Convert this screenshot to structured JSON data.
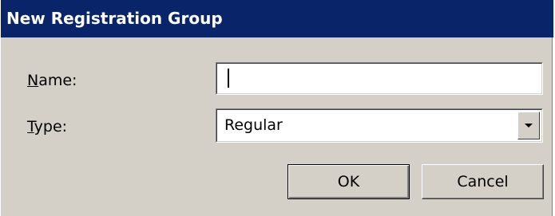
{
  "window": {
    "title": "New Registration Group"
  },
  "form": {
    "name": {
      "label_accel": "N",
      "label_rest": "ame:",
      "value": ""
    },
    "type": {
      "label_accel": "T",
      "label_rest": "ype:",
      "selected": "Regular"
    }
  },
  "buttons": {
    "ok": "OK",
    "cancel": "Cancel"
  },
  "icons": {
    "dropdown": "chevron-down-icon"
  },
  "colors": {
    "titlebar": "#0a246a",
    "face": "#d4d0c8",
    "field": "#ffffff"
  }
}
